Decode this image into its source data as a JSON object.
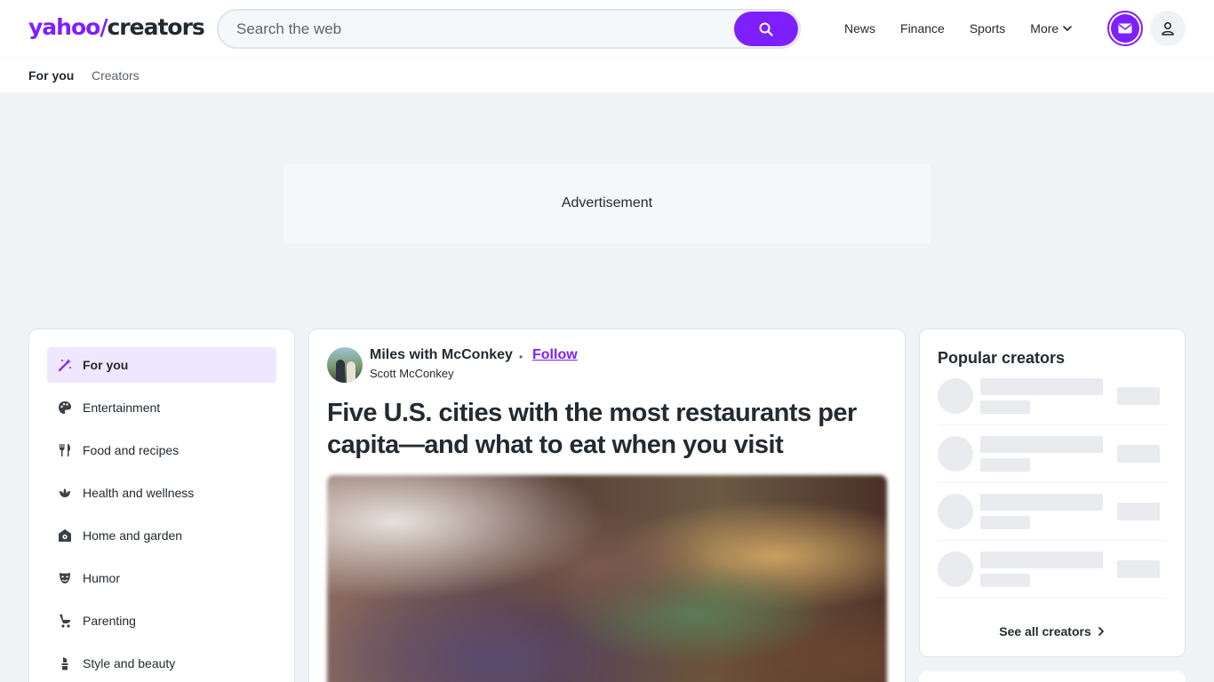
{
  "header": {
    "logo_main": "yahoo",
    "logo_bang": "/",
    "logo_sub": "creators",
    "search_placeholder": "Search the web",
    "nav": [
      "News",
      "Finance",
      "Sports",
      "More"
    ]
  },
  "subnav": {
    "items": [
      "For you",
      "Creators"
    ]
  },
  "ad": {
    "label": "Advertisement"
  },
  "sidebar": {
    "items": [
      {
        "label": "For you",
        "icon": "magic-wand-icon",
        "active": true
      },
      {
        "label": "Entertainment",
        "icon": "palette-icon"
      },
      {
        "label": "Food and recipes",
        "icon": "fork-knife-icon"
      },
      {
        "label": "Health and wellness",
        "icon": "lotus-icon"
      },
      {
        "label": "Home and garden",
        "icon": "house-gear-icon"
      },
      {
        "label": "Humor",
        "icon": "mask-icon"
      },
      {
        "label": "Parenting",
        "icon": "stroller-icon"
      },
      {
        "label": "Style and beauty",
        "icon": "lipstick-icon"
      }
    ]
  },
  "article": {
    "channel": "Miles with McConkey",
    "follow": "Follow",
    "author": "Scott McConkey",
    "headline": "Five U.S. cities with the most restaurants per capita—and what to eat when you visit"
  },
  "rail": {
    "title": "Popular creators",
    "see_all": "See all creators"
  },
  "colors": {
    "accent": "#7e1fff",
    "text": "#232a31",
    "muted": "#5b636a",
    "bg": "#f0f3f5"
  }
}
